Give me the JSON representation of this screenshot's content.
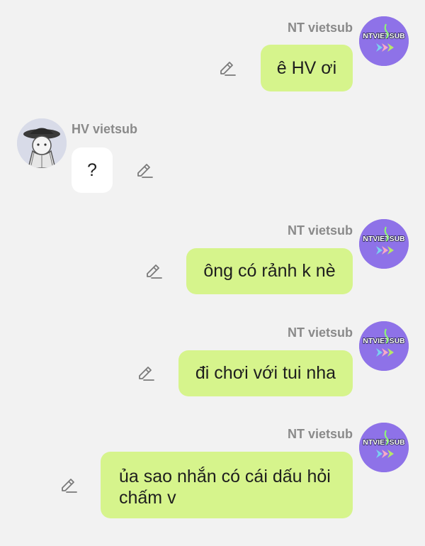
{
  "colors": {
    "background": "#f2f2f2",
    "outgoing_bubble": "#d6f48c",
    "incoming_bubble": "#ffffff",
    "sender_name": "#8a8a8a",
    "nt_avatar": "#8e72e8"
  },
  "nt_avatar_text": "NTVIETSUB",
  "messages": [
    {
      "sender": "NT vietsub",
      "text": "ê HV ơi",
      "direction": "outgoing"
    },
    {
      "sender": "HV vietsub",
      "text": "?",
      "direction": "incoming"
    },
    {
      "sender": "NT vietsub",
      "text": "ông có rảnh k nè",
      "direction": "outgoing"
    },
    {
      "sender": "NT vietsub",
      "text": "đi chơi với tui nha",
      "direction": "outgoing"
    },
    {
      "sender": "NT vietsub",
      "text_line1": "ủa sao nhắn có cái dấu hỏi",
      "text_line2": "chấm v",
      "direction": "outgoing"
    }
  ]
}
